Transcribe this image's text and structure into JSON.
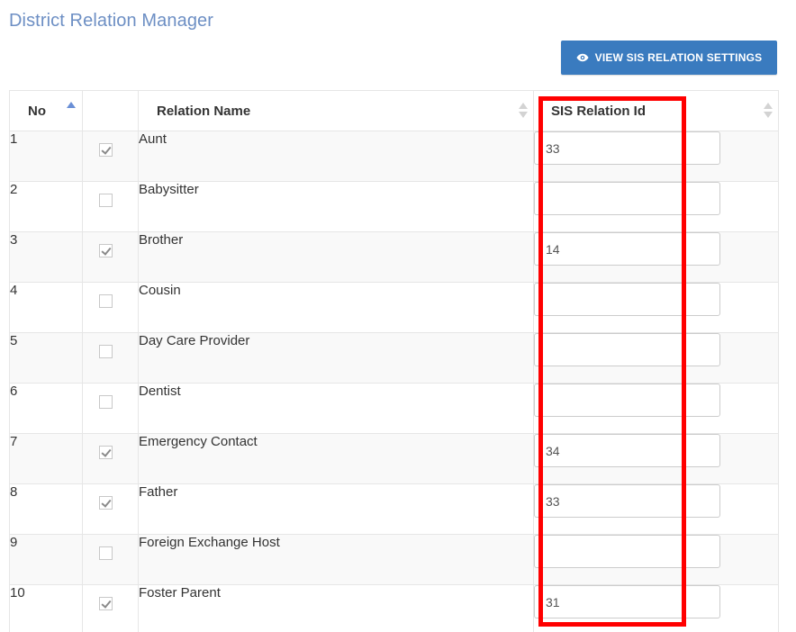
{
  "page": {
    "title": "District Relation Manager"
  },
  "toolbar": {
    "view_settings_label": "VIEW SIS RELATION SETTINGS",
    "view_settings_icon": "eye-icon"
  },
  "colors": {
    "title": "#6d8fc4",
    "button_bg": "#3a7bbf",
    "highlight": "#ff0000",
    "sort_active": "#6a8fd6"
  },
  "table": {
    "columns": {
      "no": "No",
      "check": "",
      "name": "Relation Name",
      "sis": "SIS Relation Id"
    },
    "sort": {
      "column": "no",
      "direction": "asc"
    },
    "rows": [
      {
        "no": "1",
        "checked": true,
        "name": "Aunt",
        "sis_id": "33"
      },
      {
        "no": "2",
        "checked": false,
        "name": "Babysitter",
        "sis_id": ""
      },
      {
        "no": "3",
        "checked": true,
        "name": "Brother",
        "sis_id": "14"
      },
      {
        "no": "4",
        "checked": false,
        "name": "Cousin",
        "sis_id": ""
      },
      {
        "no": "5",
        "checked": false,
        "name": "Day Care Provider",
        "sis_id": ""
      },
      {
        "no": "6",
        "checked": false,
        "name": "Dentist",
        "sis_id": ""
      },
      {
        "no": "7",
        "checked": true,
        "name": "Emergency Contact",
        "sis_id": "34"
      },
      {
        "no": "8",
        "checked": true,
        "name": "Father",
        "sis_id": "33"
      },
      {
        "no": "9",
        "checked": false,
        "name": "Foreign Exchange Host",
        "sis_id": ""
      },
      {
        "no": "10",
        "checked": true,
        "name": "Foster Parent",
        "sis_id": "31"
      }
    ]
  }
}
